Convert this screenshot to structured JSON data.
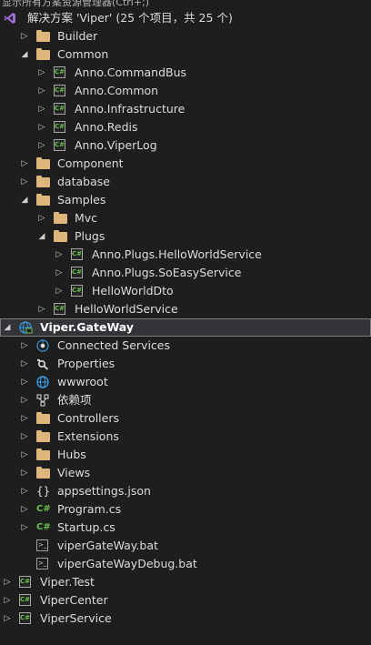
{
  "header": {
    "cut_title": "显示所有方案资源管理器(Ctrl+;)"
  },
  "solution": {
    "label": "解决方案 'Viper' (25 个项目，共 25 个)"
  },
  "tree": [
    {
      "label": "Builder",
      "icon": "folder-icon",
      "depth": 1,
      "state": "collapsed"
    },
    {
      "label": "Common",
      "icon": "folder-icon",
      "depth": 1,
      "state": "expanded"
    },
    {
      "label": "Anno.CommandBus",
      "icon": "csharp-project-icon",
      "depth": 2,
      "state": "collapsed"
    },
    {
      "label": "Anno.Common",
      "icon": "csharp-project-icon",
      "depth": 2,
      "state": "collapsed"
    },
    {
      "label": "Anno.Infrastructure",
      "icon": "csharp-project-icon",
      "depth": 2,
      "state": "collapsed"
    },
    {
      "label": "Anno.Redis",
      "icon": "csharp-project-icon",
      "depth": 2,
      "state": "collapsed"
    },
    {
      "label": "Anno.ViperLog",
      "icon": "csharp-project-icon",
      "depth": 2,
      "state": "collapsed"
    },
    {
      "label": "Component",
      "icon": "folder-icon",
      "depth": 1,
      "state": "collapsed"
    },
    {
      "label": "database",
      "icon": "folder-icon",
      "depth": 1,
      "state": "collapsed"
    },
    {
      "label": "Samples",
      "icon": "folder-icon",
      "depth": 1,
      "state": "expanded"
    },
    {
      "label": "Mvc",
      "icon": "folder-icon",
      "depth": 2,
      "state": "collapsed"
    },
    {
      "label": "Plugs",
      "icon": "folder-icon",
      "depth": 2,
      "state": "expanded"
    },
    {
      "label": "Anno.Plugs.HelloWorldService",
      "icon": "csharp-project-icon",
      "depth": 3,
      "state": "collapsed"
    },
    {
      "label": "Anno.Plugs.SoEasyService",
      "icon": "csharp-project-icon",
      "depth": 3,
      "state": "collapsed"
    },
    {
      "label": "HelloWorldDto",
      "icon": "csharp-project-icon",
      "depth": 3,
      "state": "collapsed"
    },
    {
      "label": "HelloWorldService",
      "icon": "csharp-project-icon",
      "depth": 2,
      "state": "collapsed"
    },
    {
      "label": "Viper.GateWay",
      "icon": "web-project-icon",
      "depth": 0,
      "state": "expanded",
      "selected": true,
      "bold": true
    },
    {
      "label": "Connected Services",
      "icon": "connected-services-icon",
      "depth": 1,
      "state": "collapsed"
    },
    {
      "label": "Properties",
      "icon": "properties-icon",
      "depth": 1,
      "state": "collapsed"
    },
    {
      "label": "wwwroot",
      "icon": "globe-icon",
      "depth": 1,
      "state": "collapsed"
    },
    {
      "label": "依赖项",
      "icon": "dependencies-icon",
      "depth": 1,
      "state": "collapsed"
    },
    {
      "label": "Controllers",
      "icon": "folder-icon",
      "depth": 1,
      "state": "collapsed"
    },
    {
      "label": "Extensions",
      "icon": "folder-icon",
      "depth": 1,
      "state": "collapsed"
    },
    {
      "label": "Hubs",
      "icon": "folder-icon",
      "depth": 1,
      "state": "collapsed"
    },
    {
      "label": "Views",
      "icon": "folder-icon",
      "depth": 1,
      "state": "collapsed"
    },
    {
      "label": "appsettings.json",
      "icon": "json-file-icon",
      "depth": 1,
      "state": "collapsed"
    },
    {
      "label": "Program.cs",
      "icon": "csharp-file-icon",
      "depth": 1,
      "state": "collapsed"
    },
    {
      "label": "Startup.cs",
      "icon": "csharp-file-icon",
      "depth": 1,
      "state": "collapsed"
    },
    {
      "label": "viperGateWay.bat",
      "icon": "batch-file-icon",
      "depth": 1,
      "state": "none"
    },
    {
      "label": "viperGateWayDebug.bat",
      "icon": "batch-file-icon",
      "depth": 1,
      "state": "none"
    },
    {
      "label": "Viper.Test",
      "icon": "csharp-project-icon",
      "depth": 0,
      "state": "collapsed"
    },
    {
      "label": "ViperCenter",
      "icon": "csharp-project-icon",
      "depth": 0,
      "state": "collapsed"
    },
    {
      "label": "ViperService",
      "icon": "csharp-project-icon",
      "depth": 0,
      "state": "collapsed"
    }
  ],
  "colors": {
    "background": "#1e1e1e",
    "text": "#dcdcdc",
    "folder": "#dcb67a",
    "csharp": "#68c04a",
    "selection": "#333437",
    "vs_purple": "#9b6bd6",
    "globe_blue": "#3a96dd"
  }
}
